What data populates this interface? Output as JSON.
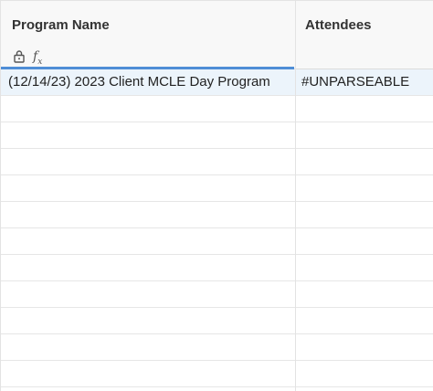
{
  "columns": [
    {
      "label": "Program Name"
    },
    {
      "label": "Attendees"
    }
  ],
  "header_icons": [
    "lock-icon",
    "formula-icon"
  ],
  "formula_symbol": "f",
  "formula_sub": "x",
  "rows": [
    {
      "program_name": "(12/14/23) 2023 Client MCLE Day Program",
      "attendees": "#UNPARSEABLE"
    }
  ],
  "colors": {
    "accent": "#4f8ed6",
    "selected_row": "#ecf4fb"
  }
}
